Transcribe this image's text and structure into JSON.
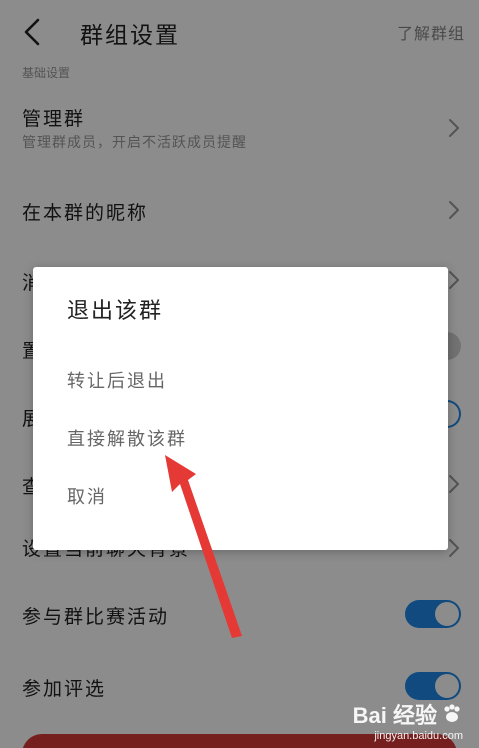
{
  "header": {
    "title": "群组设置",
    "link": "了解群组",
    "section_label": "基础设置"
  },
  "settings": {
    "manage_group": {
      "label": "管理群",
      "subtitle": "管理群成员，开启不活跃成员提醒"
    },
    "nickname": {
      "label": "在本群的昵称"
    },
    "row_partial_1": {
      "label": "消"
    },
    "row_partial_2": {
      "label": "置"
    },
    "row_partial_3": {
      "label": "展"
    },
    "row_partial_4": {
      "label": "查"
    },
    "row_partial_5": {
      "label": "设置当前聊天背景"
    },
    "contest": {
      "label": "参与群比赛活动",
      "toggle_on": true
    },
    "vote": {
      "label": "参加评选",
      "toggle_on": true
    }
  },
  "dialog": {
    "title": "退出该群",
    "options": [
      {
        "label": "转让后退出"
      },
      {
        "label": "直接解散该群"
      },
      {
        "label": "取消"
      }
    ]
  },
  "watermark": {
    "brand": "Bai 经验",
    "url": "jingyan.baidu.com"
  },
  "colors": {
    "accent": "#1e88e5",
    "danger": "#d83a3a",
    "annotation": "#e53935"
  },
  "icons": [
    "back-arrow-icon",
    "chevron-right-icon",
    "paw-icon"
  ]
}
